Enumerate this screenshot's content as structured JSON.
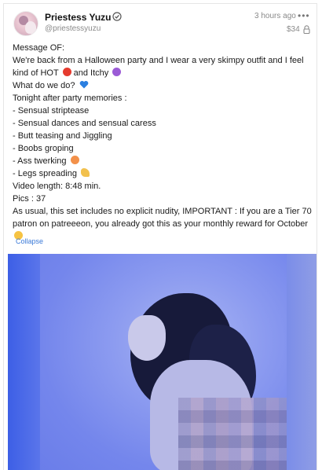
{
  "post": {
    "author": {
      "name": "Priestess Yuzu",
      "handle": "@priestessyuzu"
    },
    "meta": {
      "time": "3 hours ago",
      "price": "$34"
    },
    "icons": {
      "verified": "verified-badge-icon",
      "more": "more-options-icon",
      "lock": "lock-icon",
      "hot": "angry-face-emoji",
      "itchy": "devil-face-emoji",
      "heart": "blue-heart-emoji",
      "peach": "peach-emoji",
      "leg": "leg-emoji",
      "hot_face": "hot-face-emoji"
    },
    "body": {
      "l1": "Message OF:",
      "l2": "We're back from a Halloween party and I wear a very skimpy outfit and I feel",
      "l3a": "kind of HOT",
      "l3b": "and Itchy",
      "l4": "What do we do?",
      "l5": "Tonight after party memories :",
      "l6": "- Sensual striptease",
      "l7": "- Sensual dances and sensual caress",
      "l8": "- Butt teasing and Jiggling",
      "l9": "- Boobs groping",
      "l10": "- Ass twerking",
      "l11": "- Legs spreading",
      "l12": "Video length: 8:48 min.",
      "l13": "Pics : 37",
      "l14": "As usual, this set includes no explicit nudity, IMPORTANT : If you are a Tier 70 patron on patreeeon, you already got this as your monthly reward for October"
    },
    "collapse_label": "Collapse",
    "colors": {
      "link": "#3b7ad8",
      "muted": "#8a8a8a",
      "media_bg": "#4463e9"
    }
  }
}
